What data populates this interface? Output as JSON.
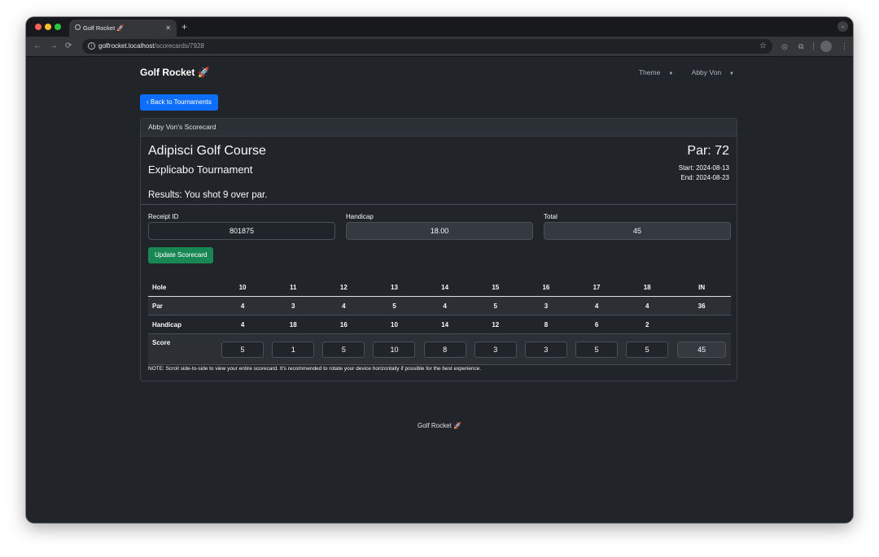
{
  "browser": {
    "tab_title": "Golf Rocket 🚀",
    "tab_close": "✕",
    "new_tab": "+",
    "url_host": "golfrocket.localhost",
    "url_path": "/scorecards/7928"
  },
  "navbar": {
    "brand": "Golf Rocket 🚀",
    "theme_label": "Theme",
    "user_label": "Abby Von"
  },
  "back_button": "Back to Tournaments",
  "card": {
    "header": "Abby Von's Scorecard",
    "course": "Adipisci Golf Course",
    "tournament": "Explicabo Tournament",
    "par": "Par: 72",
    "start": "Start: 2024-08-13",
    "end": "End: 2024-08-23",
    "results": "Results: You shot 9 over par."
  },
  "fields": {
    "receipt_label": "Receipt ID",
    "receipt_value": "801875",
    "handicap_label": "Handicap",
    "handicap_value": "18.00",
    "total_label": "Total",
    "total_value": "45"
  },
  "update_button": "Update Scorecard",
  "table": {
    "headers": [
      "Hole",
      "10",
      "11",
      "12",
      "13",
      "14",
      "15",
      "16",
      "17",
      "18",
      "IN"
    ],
    "par": [
      "Par",
      "4",
      "3",
      "4",
      "5",
      "4",
      "5",
      "3",
      "4",
      "4",
      "36"
    ],
    "handicap": [
      "Handicap",
      "4",
      "18",
      "16",
      "10",
      "14",
      "12",
      "8",
      "6",
      "2",
      ""
    ],
    "score_label": "Score",
    "scores": [
      "5",
      "1",
      "5",
      "10",
      "8",
      "3",
      "3",
      "5",
      "5"
    ],
    "score_total": "45"
  },
  "note": "NOTE: Scroll side-to-side to view your entire scorecard. It's recommended to rotate your device horizontally if possible for the best experience.",
  "footer": "Golf Rocket 🚀"
}
